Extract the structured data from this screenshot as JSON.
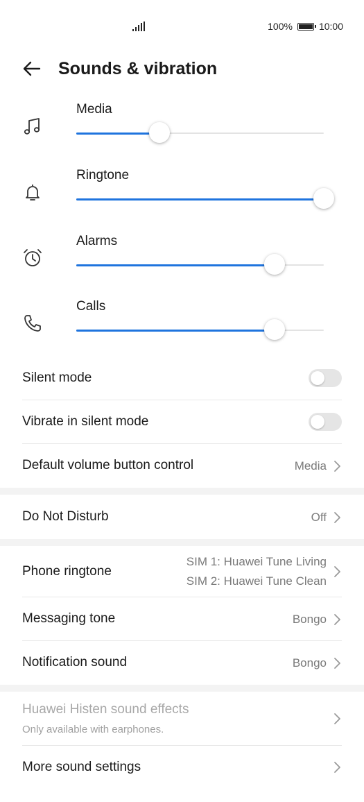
{
  "status_bar": {
    "battery_percent": "100%",
    "time": "10:00",
    "signal_icon": "signal-icon",
    "battery_icon": "battery-icon"
  },
  "header": {
    "title": "Sounds & vibration",
    "back_icon": "back-arrow-icon"
  },
  "volume_sliders": [
    {
      "label": "Media",
      "icon": "music-note-icon",
      "level": 0.335
    },
    {
      "label": "Ringtone",
      "icon": "bell-icon",
      "level": 1.0
    },
    {
      "label": "Alarms",
      "icon": "alarm-clock-icon",
      "level": 0.8
    },
    {
      "label": "Calls",
      "icon": "phone-icon",
      "level": 0.8
    }
  ],
  "toggles": {
    "silent_mode": {
      "label": "Silent mode",
      "on": false
    },
    "vibrate_silent": {
      "label": "Vibrate in silent mode",
      "on": false
    }
  },
  "settings": {
    "default_volume": {
      "label": "Default volume button control",
      "value": "Media"
    },
    "do_not_disturb": {
      "label": "Do Not Disturb",
      "value": "Off"
    },
    "phone_ringtone": {
      "label": "Phone ringtone",
      "value_sim1": "SIM 1: Huawei Tune Living",
      "value_sim2": "SIM 2: Huawei Tune Clean"
    },
    "messaging_tone": {
      "label": "Messaging tone",
      "value": "Bongo"
    },
    "notification_sound": {
      "label": "Notification sound",
      "value": "Bongo"
    },
    "histen": {
      "label": "Huawei Histen sound effects",
      "subtitle": "Only available with earphones."
    },
    "more_sound": {
      "label": "More sound settings"
    }
  },
  "colors": {
    "accent": "#1f74de",
    "track": "#e3e3e3",
    "text_primary": "#1a1a1a",
    "text_secondary": "#7a7a7a",
    "text_disabled": "#a8a8a8"
  }
}
